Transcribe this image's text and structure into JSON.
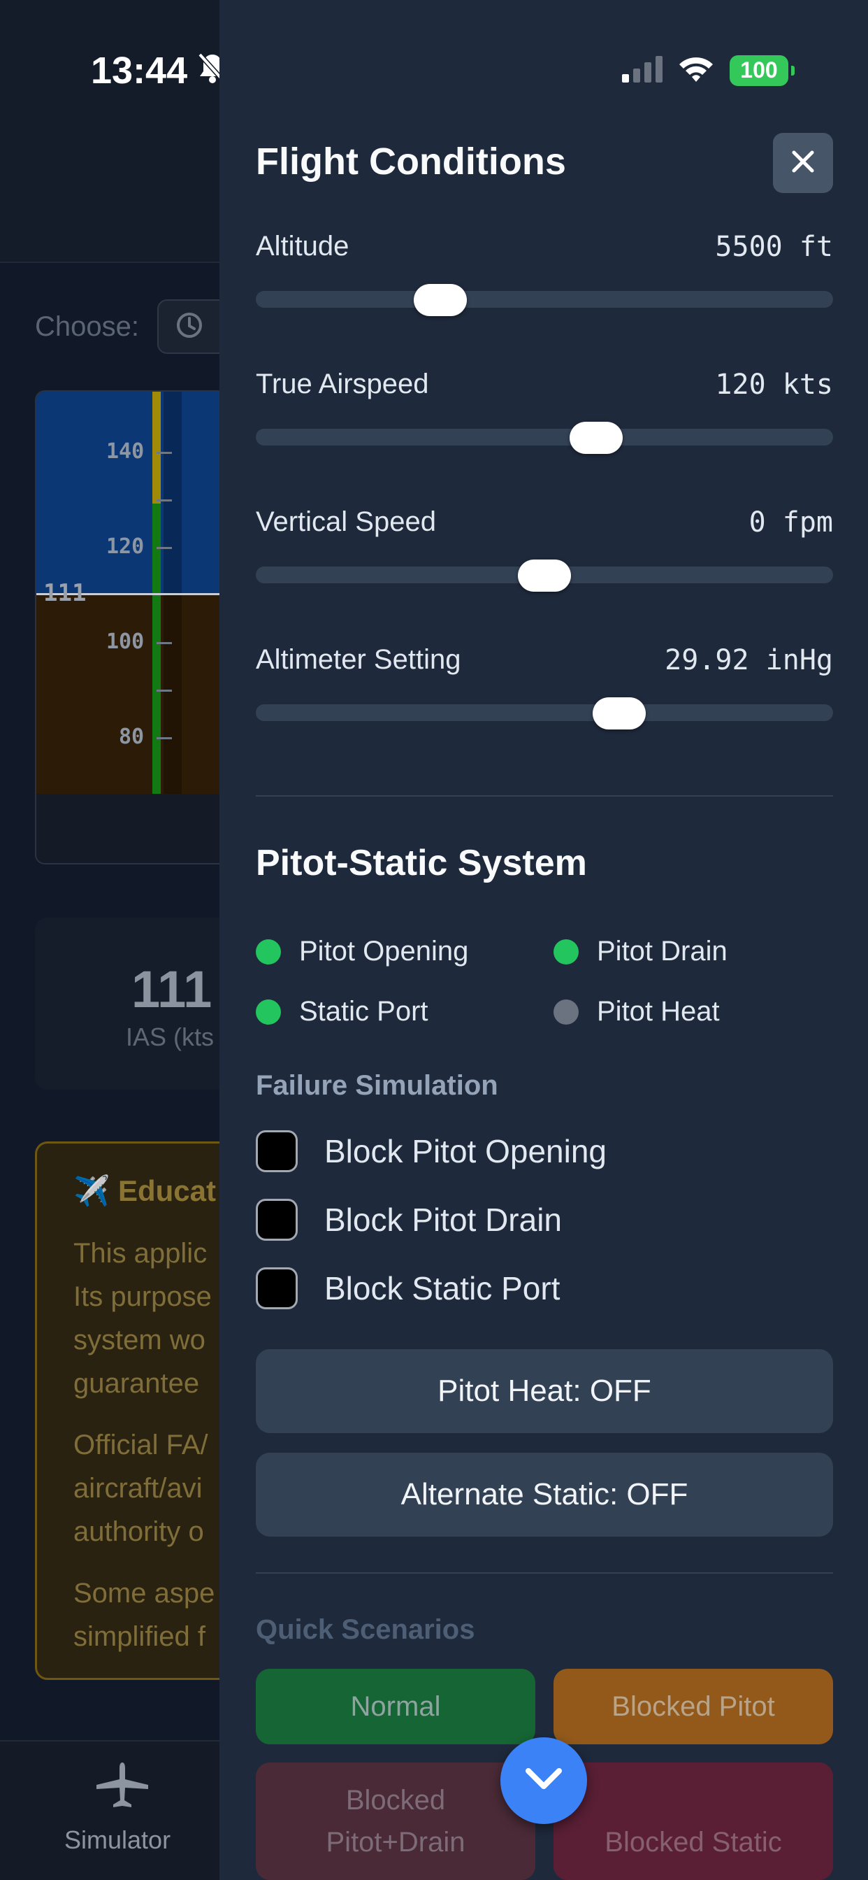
{
  "status_bar": {
    "time": "13:44",
    "battery": "100"
  },
  "background": {
    "choose_label": "Choose:",
    "gauge": {
      "ticks": [
        "140",
        "120",
        "100",
        "80"
      ],
      "current": "111"
    },
    "readout": {
      "value": "111",
      "label": "IAS (kts"
    },
    "education": {
      "title": "Educat",
      "para1": "This applic\nIts purpose\nsystem wo\nguarantee",
      "para2": "Official FA/\naircraft/avi\nauthority o",
      "para3": "Some aspe\nsimplified f"
    },
    "nav": {
      "simulator_label": "Simulator"
    }
  },
  "panel": {
    "title": "Flight Conditions",
    "sliders": [
      {
        "label": "Altitude",
        "value": "5500 ft",
        "fraction": 0.32
      },
      {
        "label": "True Airspeed",
        "value": "120 kts",
        "fraction": 0.59
      },
      {
        "label": "Vertical Speed",
        "value": "0 fpm",
        "fraction": 0.5
      },
      {
        "label": "Altimeter Setting",
        "value": "29.92 inHg",
        "fraction": 0.63
      }
    ],
    "pitot_static": {
      "title": "Pitot-Static System",
      "indicators": [
        {
          "label": "Pitot Opening",
          "state": "on"
        },
        {
          "label": "Pitot Drain",
          "state": "on"
        },
        {
          "label": "Static Port",
          "state": "on"
        },
        {
          "label": "Pitot Heat",
          "state": "off"
        }
      ]
    },
    "failure": {
      "title": "Failure Simulation",
      "options": [
        {
          "label": "Block Pitot Opening",
          "checked": false
        },
        {
          "label": "Block Pitot Drain",
          "checked": false
        },
        {
          "label": "Block Static Port",
          "checked": false
        }
      ]
    },
    "pitot_heat_button": "Pitot Heat: OFF",
    "alternate_static_button": "Alternate Static: OFF",
    "quick_scenarios": {
      "title": "Quick Scenarios",
      "normal": "Normal",
      "blocked_pitot": "Blocked Pitot",
      "blocked_pitot_drain": "Blocked\nPitot+Drain",
      "blocked_static": "Blocked Static"
    }
  },
  "colors": {
    "accent": "#3b82f6",
    "panel_bg": "#1e293b",
    "indicator_on": "#22c55e",
    "indicator_off": "#6b7280"
  }
}
